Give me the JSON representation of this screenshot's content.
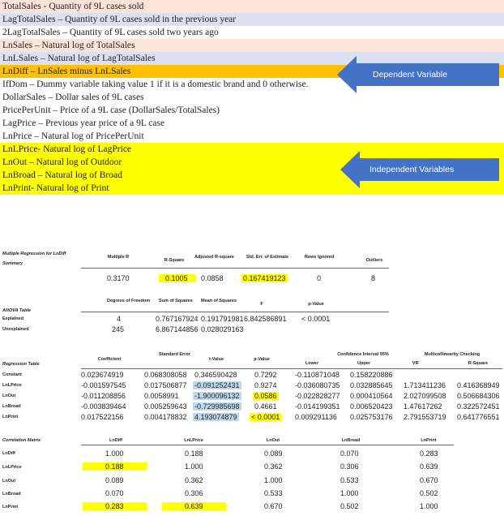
{
  "definitions": [
    {
      "text": "TotalSales - Quantity of 9L cases sold",
      "bg": "#fce4d6"
    },
    {
      "text": "LagTotalSales – Quantity of 9L cases sold in the previous year",
      "bg": "#d9e1f2"
    },
    {
      "text": "2LagTotalSales – Quantity of 9L cases sold two years ago",
      "bg": "#ffffff"
    },
    {
      "text": "LnSales – Natural log of TotalSales",
      "bg": "#fce4d6"
    },
    {
      "text": "LnLSales – Natural log of LagTotalSales",
      "bg": "#d9e1f2"
    },
    {
      "text": "LnDiff – LnSales minus LnLSales",
      "bg": "#ffc000"
    },
    {
      "text": "IfDom – Dummy variable taking value 1 if it is a domestic brand and 0 otherwise.",
      "bg": "#ffffff"
    },
    {
      "text": "DollarSales – Dollar sales of 9L cases",
      "bg": "#ffffff"
    },
    {
      "text": "PricePerUnit – Price of a 9L case (DollarSales/TotalSales)",
      "bg": "#ffffff"
    },
    {
      "text": "LagPrice – Previous year price of a 9L case",
      "bg": "#ffffff"
    },
    {
      "text": "LnPrice – Natural log of PricePerUnit",
      "bg": "#ffffff"
    },
    {
      "text": "LnLPrice- Natural log of LagPrice",
      "bg": "#ffff00"
    },
    {
      "text": "LnOut – Natural log of Outdoor",
      "bg": "#ffff00"
    },
    {
      "text": "LnBroad – Natural log of Broad",
      "bg": "#ffff00"
    },
    {
      "text": "LnPrint- Natural log of Print",
      "bg": "#ffff00"
    }
  ],
  "callouts": {
    "dependent": "Dependent Variable",
    "independent": "Independent Variables",
    "color": "#4472c4"
  },
  "summary": {
    "title": "Multiple Regression for LnDiff",
    "row_label": "Summary",
    "headers": [
      "Multiple R",
      "R-Square",
      "Adjusted R-square",
      "Std. Err. of Estimate",
      "Rows Ignored",
      "Outliers"
    ],
    "values": [
      "0.3170",
      "0.1005",
      "0.0858",
      "0.167419123",
      "0",
      "8"
    ]
  },
  "anova": {
    "title": "ANOVA Table",
    "headers": [
      "Degrees of Freedom",
      "Sum of Squares",
      "Mean of Squares",
      "F",
      "p-Value"
    ],
    "rows": [
      {
        "label": "Explained",
        "df": "4",
        "ss": "0.767167924",
        "ms": "0.191791981",
        "f": "6.842586891",
        "p": "< 0.0001"
      },
      {
        "label": "Unexplained",
        "df": "245",
        "ss": "6.867144856",
        "ms": "0.028029163",
        "f": "",
        "p": ""
      }
    ]
  },
  "regression": {
    "title": "Regression Table",
    "headers": {
      "coef": "Coefficient",
      "se": "Standard Error",
      "t": "t-Value",
      "p": "p-Value",
      "ci": "Confidence Interval 95%",
      "lower": "Lower",
      "upper": "Upper",
      "mc": "Multicollinearity Checking",
      "vif": "VIF",
      "r2": "R-Square"
    },
    "rows": [
      {
        "label": "Constant",
        "coef": "0.023674919",
        "se": "0.068308058",
        "t": "0.346590428",
        "p": "0.7292",
        "lower": "-0.110871048",
        "upper": "0.158220886",
        "vif": "",
        "r2": ""
      },
      {
        "label": "LnLPrice",
        "coef": "-0.001597545",
        "se": "0.017506877",
        "t": "-0.091252431",
        "p": "0.9274",
        "lower": "-0.036080735",
        "upper": "0.032885645",
        "vif": "1.713411236",
        "r2": "0.416368949"
      },
      {
        "label": "LnOut",
        "coef": "-0.011208856",
        "se": "0.0058991",
        "t": "-1.900096132",
        "p": "0.0586",
        "lower": "-0.022828277",
        "upper": "0.000410564",
        "vif": "2.027099508",
        "r2": "0.506684306"
      },
      {
        "label": "LnBroad",
        "coef": "-0.003839464",
        "se": "0.005259643",
        "t": "-0.729985698",
        "p": "0.4661",
        "lower": "-0.014199351",
        "upper": "0.006520423",
        "vif": "1.47617262",
        "r2": "0.322572451"
      },
      {
        "label": "LnPrint",
        "coef": "0.017522156",
        "se": "0.004178832",
        "t": "4.193074879",
        "p": "< 0.0001",
        "lower": "0.009291136",
        "upper": "0.025753176",
        "vif": "2.791553719",
        "r2": "0.641776551"
      }
    ]
  },
  "correlation": {
    "title": "Correlation Matrix",
    "headers": [
      "LnDiff",
      "LnLPrice",
      "LnOut",
      "LnBroad",
      "LnPrint"
    ],
    "rows": [
      {
        "label": "LnDiff",
        "values": [
          "1.000",
          "0.188",
          "0.089",
          "0.070",
          "0.283"
        ]
      },
      {
        "label": "LnLPrice",
        "values": [
          "0.188",
          "1.000",
          "0.362",
          "0.306",
          "0.639"
        ]
      },
      {
        "label": "LnOut",
        "values": [
          "0.089",
          "0.362",
          "1.000",
          "0.533",
          "0.670"
        ]
      },
      {
        "label": "LnBroad",
        "values": [
          "0.070",
          "0.306",
          "0.533",
          "1.000",
          "0.502"
        ]
      },
      {
        "label": "LnPrint",
        "values": [
          "0.283",
          "0.639",
          "0.670",
          "0.502",
          "1.000"
        ]
      }
    ]
  },
  "highlight_colors": {
    "yellow": "#ffff00",
    "blue": "#bfd9ef"
  }
}
